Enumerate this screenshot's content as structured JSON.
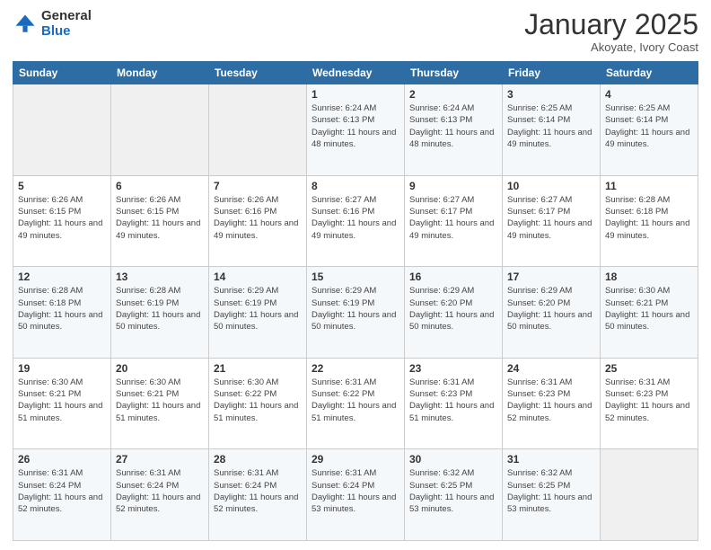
{
  "header": {
    "logo": {
      "general": "General",
      "blue": "Blue"
    },
    "title": "January 2025",
    "subtitle": "Akoyate, Ivory Coast"
  },
  "weekdays": [
    "Sunday",
    "Monday",
    "Tuesday",
    "Wednesday",
    "Thursday",
    "Friday",
    "Saturday"
  ],
  "weeks": [
    [
      {
        "day": "",
        "sunrise": "",
        "sunset": "",
        "daylight": ""
      },
      {
        "day": "",
        "sunrise": "",
        "sunset": "",
        "daylight": ""
      },
      {
        "day": "",
        "sunrise": "",
        "sunset": "",
        "daylight": ""
      },
      {
        "day": "1",
        "sunrise": "Sunrise: 6:24 AM",
        "sunset": "Sunset: 6:13 PM",
        "daylight": "Daylight: 11 hours and 48 minutes."
      },
      {
        "day": "2",
        "sunrise": "Sunrise: 6:24 AM",
        "sunset": "Sunset: 6:13 PM",
        "daylight": "Daylight: 11 hours and 48 minutes."
      },
      {
        "day": "3",
        "sunrise": "Sunrise: 6:25 AM",
        "sunset": "Sunset: 6:14 PM",
        "daylight": "Daylight: 11 hours and 49 minutes."
      },
      {
        "day": "4",
        "sunrise": "Sunrise: 6:25 AM",
        "sunset": "Sunset: 6:14 PM",
        "daylight": "Daylight: 11 hours and 49 minutes."
      }
    ],
    [
      {
        "day": "5",
        "sunrise": "Sunrise: 6:26 AM",
        "sunset": "Sunset: 6:15 PM",
        "daylight": "Daylight: 11 hours and 49 minutes."
      },
      {
        "day": "6",
        "sunrise": "Sunrise: 6:26 AM",
        "sunset": "Sunset: 6:15 PM",
        "daylight": "Daylight: 11 hours and 49 minutes."
      },
      {
        "day": "7",
        "sunrise": "Sunrise: 6:26 AM",
        "sunset": "Sunset: 6:16 PM",
        "daylight": "Daylight: 11 hours and 49 minutes."
      },
      {
        "day": "8",
        "sunrise": "Sunrise: 6:27 AM",
        "sunset": "Sunset: 6:16 PM",
        "daylight": "Daylight: 11 hours and 49 minutes."
      },
      {
        "day": "9",
        "sunrise": "Sunrise: 6:27 AM",
        "sunset": "Sunset: 6:17 PM",
        "daylight": "Daylight: 11 hours and 49 minutes."
      },
      {
        "day": "10",
        "sunrise": "Sunrise: 6:27 AM",
        "sunset": "Sunset: 6:17 PM",
        "daylight": "Daylight: 11 hours and 49 minutes."
      },
      {
        "day": "11",
        "sunrise": "Sunrise: 6:28 AM",
        "sunset": "Sunset: 6:18 PM",
        "daylight": "Daylight: 11 hours and 49 minutes."
      }
    ],
    [
      {
        "day": "12",
        "sunrise": "Sunrise: 6:28 AM",
        "sunset": "Sunset: 6:18 PM",
        "daylight": "Daylight: 11 hours and 50 minutes."
      },
      {
        "day": "13",
        "sunrise": "Sunrise: 6:28 AM",
        "sunset": "Sunset: 6:19 PM",
        "daylight": "Daylight: 11 hours and 50 minutes."
      },
      {
        "day": "14",
        "sunrise": "Sunrise: 6:29 AM",
        "sunset": "Sunset: 6:19 PM",
        "daylight": "Daylight: 11 hours and 50 minutes."
      },
      {
        "day": "15",
        "sunrise": "Sunrise: 6:29 AM",
        "sunset": "Sunset: 6:19 PM",
        "daylight": "Daylight: 11 hours and 50 minutes."
      },
      {
        "day": "16",
        "sunrise": "Sunrise: 6:29 AM",
        "sunset": "Sunset: 6:20 PM",
        "daylight": "Daylight: 11 hours and 50 minutes."
      },
      {
        "day": "17",
        "sunrise": "Sunrise: 6:29 AM",
        "sunset": "Sunset: 6:20 PM",
        "daylight": "Daylight: 11 hours and 50 minutes."
      },
      {
        "day": "18",
        "sunrise": "Sunrise: 6:30 AM",
        "sunset": "Sunset: 6:21 PM",
        "daylight": "Daylight: 11 hours and 50 minutes."
      }
    ],
    [
      {
        "day": "19",
        "sunrise": "Sunrise: 6:30 AM",
        "sunset": "Sunset: 6:21 PM",
        "daylight": "Daylight: 11 hours and 51 minutes."
      },
      {
        "day": "20",
        "sunrise": "Sunrise: 6:30 AM",
        "sunset": "Sunset: 6:21 PM",
        "daylight": "Daylight: 11 hours and 51 minutes."
      },
      {
        "day": "21",
        "sunrise": "Sunrise: 6:30 AM",
        "sunset": "Sunset: 6:22 PM",
        "daylight": "Daylight: 11 hours and 51 minutes."
      },
      {
        "day": "22",
        "sunrise": "Sunrise: 6:31 AM",
        "sunset": "Sunset: 6:22 PM",
        "daylight": "Daylight: 11 hours and 51 minutes."
      },
      {
        "day": "23",
        "sunrise": "Sunrise: 6:31 AM",
        "sunset": "Sunset: 6:23 PM",
        "daylight": "Daylight: 11 hours and 51 minutes."
      },
      {
        "day": "24",
        "sunrise": "Sunrise: 6:31 AM",
        "sunset": "Sunset: 6:23 PM",
        "daylight": "Daylight: 11 hours and 52 minutes."
      },
      {
        "day": "25",
        "sunrise": "Sunrise: 6:31 AM",
        "sunset": "Sunset: 6:23 PM",
        "daylight": "Daylight: 11 hours and 52 minutes."
      }
    ],
    [
      {
        "day": "26",
        "sunrise": "Sunrise: 6:31 AM",
        "sunset": "Sunset: 6:24 PM",
        "daylight": "Daylight: 11 hours and 52 minutes."
      },
      {
        "day": "27",
        "sunrise": "Sunrise: 6:31 AM",
        "sunset": "Sunset: 6:24 PM",
        "daylight": "Daylight: 11 hours and 52 minutes."
      },
      {
        "day": "28",
        "sunrise": "Sunrise: 6:31 AM",
        "sunset": "Sunset: 6:24 PM",
        "daylight": "Daylight: 11 hours and 52 minutes."
      },
      {
        "day": "29",
        "sunrise": "Sunrise: 6:31 AM",
        "sunset": "Sunset: 6:24 PM",
        "daylight": "Daylight: 11 hours and 53 minutes."
      },
      {
        "day": "30",
        "sunrise": "Sunrise: 6:32 AM",
        "sunset": "Sunset: 6:25 PM",
        "daylight": "Daylight: 11 hours and 53 minutes."
      },
      {
        "day": "31",
        "sunrise": "Sunrise: 6:32 AM",
        "sunset": "Sunset: 6:25 PM",
        "daylight": "Daylight: 11 hours and 53 minutes."
      },
      {
        "day": "",
        "sunrise": "",
        "sunset": "",
        "daylight": ""
      }
    ]
  ]
}
